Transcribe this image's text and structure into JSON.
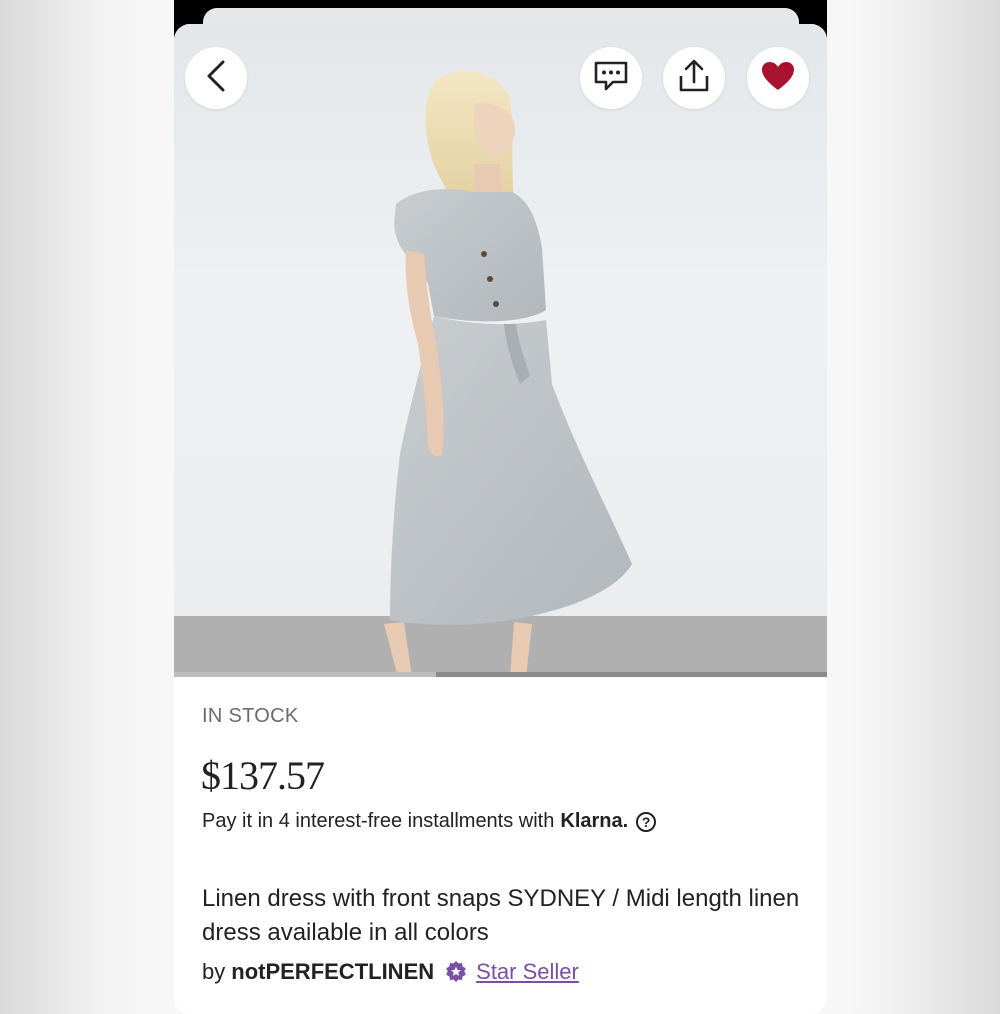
{
  "product": {
    "stock_status": "IN STOCK",
    "price": "$137.57",
    "installments_text": "Pay it in 4 interest-free installments with",
    "installments_provider": "Klarna.",
    "title": "Linen dress with front snaps SYDNEY / Midi length linen dress available in all colors",
    "by_label": "by",
    "shop_name": "notPERFECTLINEN",
    "seller_badge": "Star Seller"
  },
  "toolbar": {
    "back_icon": "chevron-left-icon",
    "message_icon": "message-icon",
    "share_icon": "share-icon",
    "favorite_icon": "heart-icon"
  },
  "colors": {
    "favorite": "#a8122e",
    "star_seller": "#7b4fa8"
  }
}
